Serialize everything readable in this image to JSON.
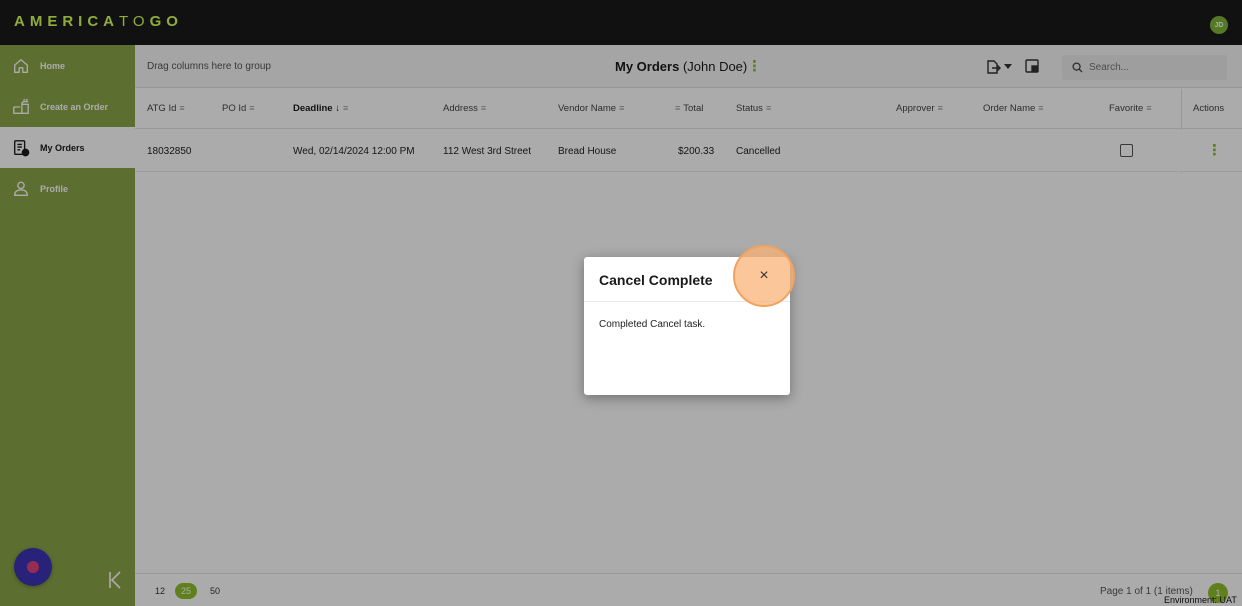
{
  "app": {
    "logo_bold": "AMERICA",
    "logo_light": "TO",
    "logo_bold_end": "GO",
    "user_initials": "JD"
  },
  "sidebar": {
    "items": [
      {
        "label": "Home",
        "icon": "home-icon"
      },
      {
        "label": "Create an Order",
        "icon": "create-order-icon"
      },
      {
        "label": "My Orders",
        "icon": "orders-icon",
        "active": true
      },
      {
        "label": "Profile",
        "icon": "profile-icon"
      }
    ],
    "collapse_glyph": "|<"
  },
  "toolbar": {
    "group_hint": "Drag columns here to group",
    "title_bold": "My Orders",
    "title_user": "(John Doe)",
    "search_placeholder": "Search..."
  },
  "grid": {
    "columns": [
      "ATG Id",
      "PO Id",
      "Deadline ↓",
      "Address",
      "Vendor Name",
      "Total",
      "Status",
      "Approver",
      "Order Name",
      "Favorite",
      "Actions"
    ],
    "rows": [
      {
        "atg_id": "18032850",
        "po_id": "",
        "deadline": "Wed, 02/14/2024 12:00 PM",
        "address": "112 West 3rd Street",
        "vendor": "Bread House",
        "total": "$200.33",
        "status": "Cancelled",
        "approver": "",
        "order_name": "",
        "favorite": false
      }
    ]
  },
  "footer": {
    "page_sizes": [
      "12",
      "25",
      "50"
    ],
    "selected_page_size": "25",
    "page_info": "Page 1 of 1 (1 items)",
    "current_page": "1",
    "environment": "Environment: UAT"
  },
  "dialog": {
    "title": "Cancel Complete",
    "message": "Completed Cancel task.",
    "close_glyph": "×"
  },
  "colors": {
    "accent_green": "#8fbf2e",
    "sidebar_green": "#8aa648",
    "topbar": "#1a1a1a",
    "logo_lime": "#d6ff5a",
    "highlight_orange": "#f2a25e"
  }
}
